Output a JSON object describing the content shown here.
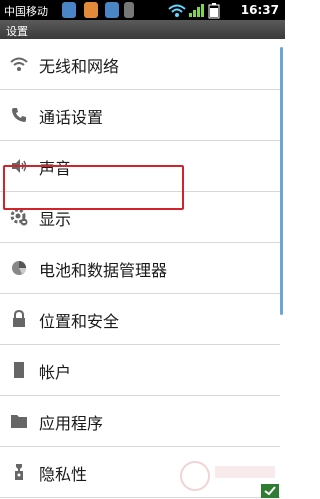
{
  "status": {
    "carrier": "中国移动",
    "time": "16:37"
  },
  "title": "设置",
  "items": [
    {
      "label": "无线和网络",
      "icon": "wifi-icon"
    },
    {
      "label": "通话设置",
      "icon": "phone-icon"
    },
    {
      "label": "声音",
      "icon": "speaker-icon"
    },
    {
      "label": "显示",
      "icon": "display-gear-icon"
    },
    {
      "label": "电池和数据管理器",
      "icon": "pie-chart-icon"
    },
    {
      "label": "位置和安全",
      "icon": "lock-icon"
    },
    {
      "label": "帐户",
      "icon": "account-icon"
    },
    {
      "label": "应用程序",
      "icon": "folder-icon"
    },
    {
      "label": "隐私性",
      "icon": "privacy-icon"
    }
  ]
}
